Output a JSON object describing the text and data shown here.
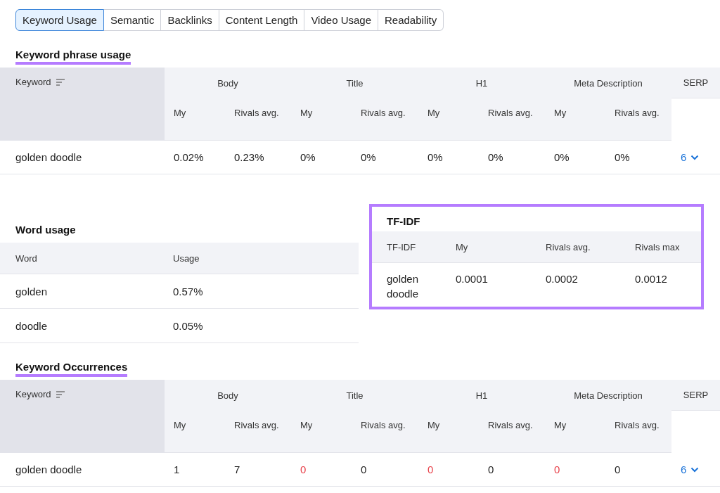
{
  "tabs": [
    {
      "label": "Keyword Usage",
      "selected": true
    },
    {
      "label": "Semantic",
      "selected": false
    },
    {
      "label": "Backlinks",
      "selected": false
    },
    {
      "label": "Content Length",
      "selected": false
    },
    {
      "label": "Video Usage",
      "selected": false
    },
    {
      "label": "Readability",
      "selected": false
    }
  ],
  "keyword_phrase_usage": {
    "title": "Keyword phrase usage",
    "keyword_header": "Keyword",
    "groups": [
      {
        "label": "Body",
        "subcolumns": [
          "My",
          "Rivals avg."
        ]
      },
      {
        "label": "Title",
        "subcolumns": [
          "My",
          "Rivals avg."
        ]
      },
      {
        "label": "H1",
        "subcolumns": [
          "My",
          "Rivals avg."
        ]
      },
      {
        "label": "Meta Description",
        "subcolumns": [
          "My",
          "Rivals avg."
        ]
      }
    ],
    "serp_header": "SERP",
    "rows": [
      {
        "keyword": "golden doodle",
        "cells": [
          {
            "text": "0.02%",
            "highlight": false
          },
          {
            "text": "0.23%",
            "highlight": false
          },
          {
            "text": "0%",
            "highlight": false
          },
          {
            "text": "0%",
            "highlight": false
          },
          {
            "text": "0%",
            "highlight": false
          },
          {
            "text": "0%",
            "highlight": false
          },
          {
            "text": "0%",
            "highlight": false
          },
          {
            "text": "0%",
            "highlight": false
          }
        ],
        "serp": "6"
      }
    ]
  },
  "word_usage": {
    "title": "Word usage",
    "columns": [
      "Word",
      "Usage"
    ],
    "rows": [
      [
        "golden",
        "0.57%"
      ],
      [
        "doodle",
        "0.05%"
      ]
    ]
  },
  "tf_idf": {
    "title": "TF-IDF",
    "columns": [
      "TF-IDF",
      "My",
      "Rivals avg.",
      "Rivals max"
    ],
    "rows": [
      [
        "golden doodle",
        "0.0001",
        "0.0002",
        "0.0012"
      ]
    ]
  },
  "keyword_occurrences": {
    "title": "Keyword Occurrences",
    "keyword_header": "Keyword",
    "groups": [
      {
        "label": "Body",
        "subcolumns": [
          "My",
          "Rivals avg."
        ]
      },
      {
        "label": "Title",
        "subcolumns": [
          "My",
          "Rivals avg."
        ]
      },
      {
        "label": "H1",
        "subcolumns": [
          "My",
          "Rivals avg."
        ]
      },
      {
        "label": "Meta Description",
        "subcolumns": [
          "My",
          "Rivals avg."
        ]
      }
    ],
    "serp_header": "SERP",
    "rows": [
      {
        "keyword": "golden doodle",
        "cells": [
          {
            "text": "1",
            "highlight": false
          },
          {
            "text": "7",
            "highlight": false
          },
          {
            "text": "0",
            "highlight": true
          },
          {
            "text": "0",
            "highlight": false
          },
          {
            "text": "0",
            "highlight": true
          },
          {
            "text": "0",
            "highlight": false
          },
          {
            "text": "0",
            "highlight": true
          },
          {
            "text": "0",
            "highlight": false
          }
        ],
        "serp": "6"
      }
    ]
  }
}
